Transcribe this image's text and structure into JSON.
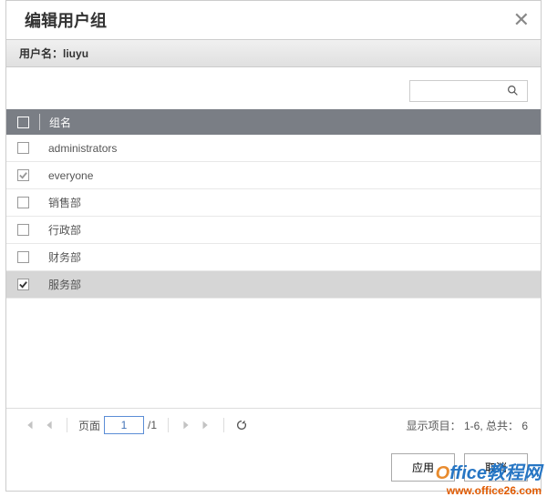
{
  "header": {
    "title": "编辑用户组",
    "close_glyph": "✕"
  },
  "userbar": {
    "label": "用户名：",
    "value": "liuyu"
  },
  "search": {
    "value": "",
    "placeholder": ""
  },
  "table": {
    "header_group": "组名",
    "rows": [
      {
        "name": "administrators",
        "checked": false,
        "selected": false,
        "grey": false
      },
      {
        "name": "everyone",
        "checked": true,
        "selected": false,
        "grey": true
      },
      {
        "name": "销售部",
        "checked": false,
        "selected": false,
        "grey": false
      },
      {
        "name": "行政部",
        "checked": false,
        "selected": false,
        "grey": false
      },
      {
        "name": "财务部",
        "checked": false,
        "selected": false,
        "grey": false
      },
      {
        "name": "服务部",
        "checked": true,
        "selected": true,
        "grey": false
      }
    ]
  },
  "pager": {
    "page_label": "页面",
    "page_value": "1",
    "page_total": "/1",
    "display_info": "显示项目： 1-6, 总共： 6"
  },
  "footer": {
    "apply": "应用",
    "cancel": "取消"
  },
  "watermark": {
    "line1a": "O",
    "line1b": "ffice教程网",
    "line2": "www.office26.com"
  }
}
